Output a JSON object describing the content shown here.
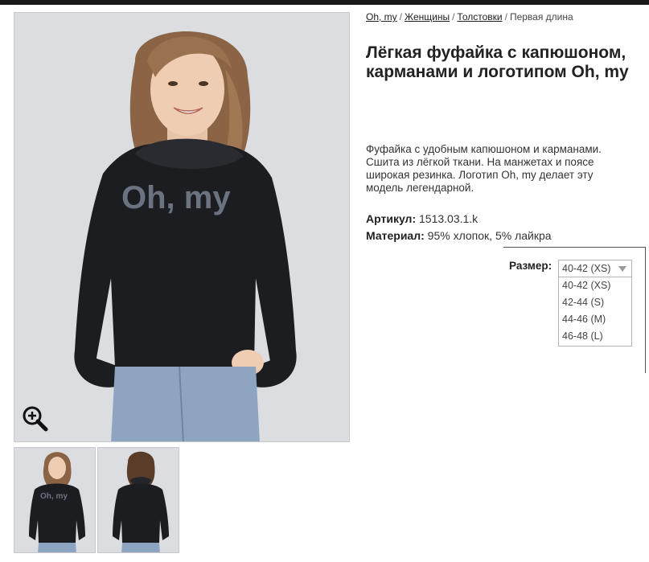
{
  "breadcrumb": {
    "items": [
      "Oh, my",
      "Женщины",
      "Толстовки"
    ],
    "separator": "/",
    "current": "Первая длина"
  },
  "product": {
    "title": "Лёгкая фуфайка с капюшоном, карманами и логотипом Oh, my",
    "description": "Фуфайка с удобным капюшоном и карманами. Сшита из лёгкой ткани. На манжетах и поясе широкая резинка. Логотип Oh, my делает эту модель легендарной.",
    "article_label": "Артикул:",
    "article_value": "1513.03.1.k",
    "material_label": "Материал:",
    "material_value": "95% хлопок, 5% лайкра",
    "shirt_logo": "Oh, my"
  },
  "size": {
    "label": "Размер:",
    "selected": "40-42 (XS)",
    "options": [
      "40-42 (XS)",
      "42-44 (S)",
      "44-46 (M)",
      "46-48 (L)"
    ]
  },
  "icons": {
    "zoom": "zoom-in-icon"
  },
  "colors": {
    "top_bar": "#1a1a1a",
    "background": "#ffffff",
    "hoodie": "#1c1d21",
    "logo": "#6b7280",
    "photo_bg": "#dcdde0"
  }
}
